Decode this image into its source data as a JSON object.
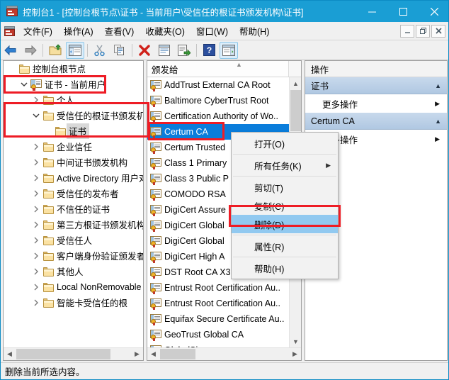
{
  "window": {
    "title": "控制台1 - [控制台根节点\\证书 - 当前用户\\受信任的根证书颁发机构\\证书]",
    "icon": "mmc-console-icon",
    "minimize_label": "最小化",
    "maximize_label": "最大化",
    "close_label": "关闭"
  },
  "menubar": {
    "items": [
      {
        "label": "文件(F)",
        "name": "menu-file"
      },
      {
        "label": "操作(A)",
        "name": "menu-action"
      },
      {
        "label": "查看(V)",
        "name": "menu-view"
      },
      {
        "label": "收藏夹(O)",
        "name": "menu-favorites"
      },
      {
        "label": "窗口(W)",
        "name": "menu-window"
      },
      {
        "label": "帮助(H)",
        "name": "menu-help"
      }
    ],
    "mdi_minimize": "_",
    "mdi_restore": "❐",
    "mdi_close": "✕"
  },
  "toolbar": {
    "buttons": [
      {
        "name": "back-icon",
        "tooltip": "后退"
      },
      {
        "name": "forward-icon",
        "tooltip": "前进"
      },
      {
        "name": "up-one-level-icon",
        "tooltip": "向上一级"
      },
      {
        "name": "show-hide-console-tree-icon",
        "tooltip": "显示/隐藏控制台树"
      },
      {
        "name": "cut-icon",
        "tooltip": "剪切"
      },
      {
        "name": "copy-icon",
        "tooltip": "复制"
      },
      {
        "name": "delete-icon",
        "tooltip": "删除"
      },
      {
        "name": "properties-icon",
        "tooltip": "属性"
      },
      {
        "name": "export-list-icon",
        "tooltip": "导出列表"
      },
      {
        "name": "help-icon",
        "tooltip": "帮助"
      },
      {
        "name": "show-hide-action-pane-icon",
        "tooltip": "显示/隐藏操作窗格"
      }
    ]
  },
  "tree": {
    "nodes": [
      {
        "label": "控制台根节点",
        "depth": 0,
        "expander": "none",
        "icon": "folder-icon",
        "selected": false
      },
      {
        "label": "证书 - 当前用户",
        "depth": 1,
        "expander": "expanded",
        "icon": "cert-store-icon",
        "selected": false
      },
      {
        "label": "个人",
        "depth": 2,
        "expander": "collapsed",
        "icon": "folder-icon",
        "selected": false
      },
      {
        "label": "受信任的根证书颁发机构",
        "depth": 2,
        "expander": "expanded",
        "icon": "folder-icon",
        "selected": false
      },
      {
        "label": "证书",
        "depth": 3,
        "expander": "none",
        "icon": "folder-icon",
        "selected": true
      },
      {
        "label": "企业信任",
        "depth": 2,
        "expander": "collapsed",
        "icon": "folder-icon",
        "selected": false
      },
      {
        "label": "中间证书颁发机构",
        "depth": 2,
        "expander": "collapsed",
        "icon": "folder-icon",
        "selected": false
      },
      {
        "label": "Active Directory 用户对象",
        "depth": 2,
        "expander": "collapsed",
        "icon": "folder-icon",
        "selected": false
      },
      {
        "label": "受信任的发布者",
        "depth": 2,
        "expander": "collapsed",
        "icon": "folder-icon",
        "selected": false
      },
      {
        "label": "不信任的证书",
        "depth": 2,
        "expander": "collapsed",
        "icon": "folder-icon",
        "selected": false
      },
      {
        "label": "第三方根证书颁发机构",
        "depth": 2,
        "expander": "collapsed",
        "icon": "folder-icon",
        "selected": false
      },
      {
        "label": "受信任人",
        "depth": 2,
        "expander": "collapsed",
        "icon": "folder-icon",
        "selected": false
      },
      {
        "label": "客户端身份验证颁发者",
        "depth": 2,
        "expander": "collapsed",
        "icon": "folder-icon",
        "selected": false
      },
      {
        "label": "其他人",
        "depth": 2,
        "expander": "collapsed",
        "icon": "folder-icon",
        "selected": false
      },
      {
        "label": "Local NonRemovable Ce",
        "depth": 2,
        "expander": "collapsed",
        "icon": "folder-icon",
        "selected": false
      },
      {
        "label": "智能卡受信任的根",
        "depth": 2,
        "expander": "collapsed",
        "icon": "folder-icon",
        "selected": false
      }
    ]
  },
  "list": {
    "column_header": "颁发给",
    "sort_indicator": "ascending",
    "rows": [
      {
        "label": "AddTrust External CA Root",
        "selected": false
      },
      {
        "label": "Baltimore CyberTrust Root",
        "selected": false
      },
      {
        "label": "Certification Authority of Wo..",
        "selected": false
      },
      {
        "label": "Certum CA",
        "selected": true
      },
      {
        "label": "Certum Trusted",
        "selected": false
      },
      {
        "label": "Class 1 Primary",
        "selected": false
      },
      {
        "label": "Class 3 Public P",
        "selected": false
      },
      {
        "label": "COMODO RSA",
        "selected": false
      },
      {
        "label": "DigiCert Assure",
        "selected": false
      },
      {
        "label": "DigiCert Global",
        "selected": false
      },
      {
        "label": "DigiCert Global",
        "selected": false
      },
      {
        "label": "DigiCert High A",
        "selected": false
      },
      {
        "label": "DST Root CA X3",
        "selected": false
      },
      {
        "label": "Entrust Root Certification Au..",
        "selected": false
      },
      {
        "label": "Entrust Root Certification Au..",
        "selected": false
      },
      {
        "label": "Equifax Secure Certificate Au..",
        "selected": false
      },
      {
        "label": "GeoTrust Global CA",
        "selected": false
      },
      {
        "label": "GlobalSign",
        "selected": false
      }
    ]
  },
  "actions": {
    "header": "操作",
    "groups": [
      {
        "title": "证书",
        "items": [
          {
            "label": "更多操作",
            "submenu": true
          }
        ]
      },
      {
        "title": "Certum CA",
        "items": [
          {
            "label": "更多操作",
            "submenu": true
          }
        ]
      }
    ]
  },
  "context_menu": {
    "items": [
      {
        "label": "打开(O)",
        "submenu": false,
        "highlighted": false,
        "separator_after": true
      },
      {
        "label": "所有任务(K)",
        "submenu": true,
        "highlighted": false,
        "separator_after": true
      },
      {
        "label": "剪切(T)",
        "submenu": false,
        "highlighted": false,
        "separator_after": false
      },
      {
        "label": "复制(C)",
        "submenu": false,
        "highlighted": false,
        "separator_after": false
      },
      {
        "label": "删除(D)",
        "submenu": false,
        "highlighted": true,
        "separator_after": true
      },
      {
        "label": "属性(R)",
        "submenu": false,
        "highlighted": false,
        "separator_after": true
      },
      {
        "label": "帮助(H)",
        "submenu": false,
        "highlighted": false,
        "separator_after": false
      }
    ]
  },
  "statusbar": {
    "text": "删除当前所选内容。"
  },
  "colors": {
    "titlebar": "#1a9ed4",
    "selection": "#0a7ddb",
    "menu_highlight": "#91c9f0",
    "annotation": "#ee1c25",
    "action_group": "#b0c8e2"
  }
}
